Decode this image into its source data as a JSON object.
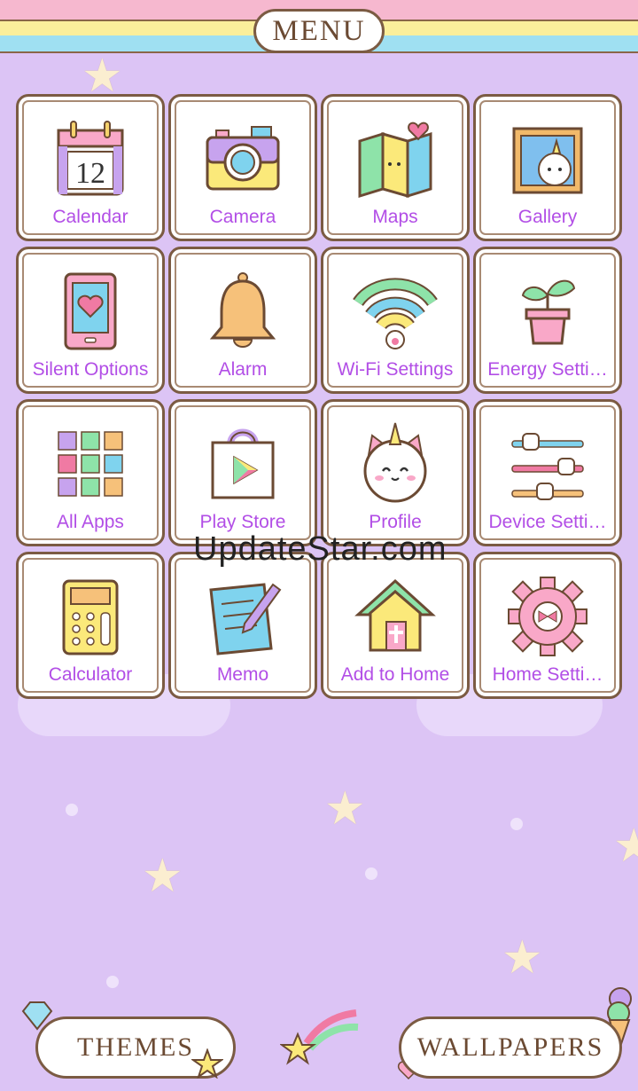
{
  "header": {
    "title": "MENU"
  },
  "grid": {
    "rows": [
      [
        {
          "label": "Calendar",
          "icon": "calendar-icon",
          "day": "12"
        },
        {
          "label": "Camera",
          "icon": "camera-icon"
        },
        {
          "label": "Maps",
          "icon": "map-icon"
        },
        {
          "label": "Gallery",
          "icon": "gallery-icon"
        }
      ],
      [
        {
          "label": "Silent Options",
          "icon": "tablet-heart-icon"
        },
        {
          "label": "Alarm",
          "icon": "bell-icon"
        },
        {
          "label": "Wi-Fi Settings",
          "icon": "wifi-icon"
        },
        {
          "label": "Energy Setti…",
          "icon": "plant-icon"
        }
      ],
      [
        {
          "label": "All Apps",
          "icon": "apps-grid-icon"
        },
        {
          "label": "Play Store",
          "icon": "play-store-icon"
        },
        {
          "label": "Profile",
          "icon": "unicorn-cat-icon"
        },
        {
          "label": "Device Setti…",
          "icon": "sliders-icon"
        }
      ],
      [
        {
          "label": "Calculator",
          "icon": "calculator-icon"
        },
        {
          "label": "Memo",
          "icon": "memo-icon"
        },
        {
          "label": "Add to Home",
          "icon": "house-icon"
        },
        {
          "label": "Home Setti…",
          "icon": "gear-icon"
        }
      ]
    ]
  },
  "watermark": "UpdateStar.com",
  "footer": {
    "themes_label": "THEMES",
    "wallpapers_label": "WALLPAPERS"
  },
  "colors": {
    "background": "#dcc4f5",
    "label": "#b24ee6",
    "border": "#7b5b43"
  }
}
